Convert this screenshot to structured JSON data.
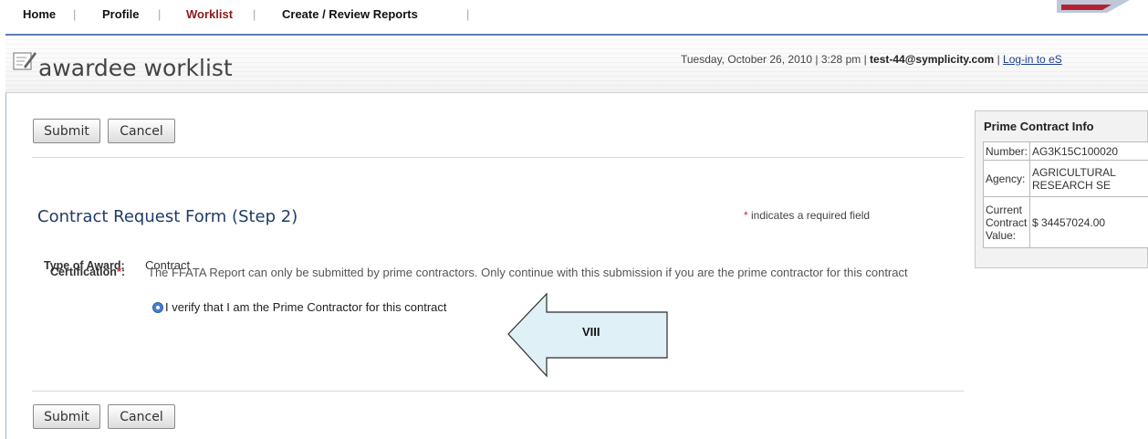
{
  "nav": {
    "items": [
      {
        "label": "Home"
      },
      {
        "label": "Profile"
      },
      {
        "label": "Worklist"
      },
      {
        "label": "Create / Review Reports"
      }
    ],
    "separator": "|"
  },
  "header": {
    "title": "awardee worklist",
    "datetime": "Tuesday, October 26, 2010 | 3:28 pm | ",
    "user": "test-44@symplicity.com",
    "sep": " | ",
    "login_link": "Log-in to eS"
  },
  "buttons": {
    "submit": "Submit",
    "cancel": "Cancel"
  },
  "form": {
    "title": "Contract Request Form (Step 2)",
    "required_star": "*",
    "required_note": " indicates a required field",
    "type_label": "Type of Award:",
    "type_value": "Contract",
    "cert_label": "Certification",
    "cert_star": "*",
    "cert_colon": ":",
    "cert_text": "The FFATA Report can only be submitted by prime contractors. Only continue with this submission if you are the prime contractor for this contract",
    "radio_label": "I verify that I am the Prime Contractor for this contract",
    "radio_checked": true
  },
  "panel": {
    "title": "Prime Contract Info",
    "rows": [
      {
        "key": "Number:",
        "value": "AG3K15C100020"
      },
      {
        "key": "Agency:",
        "value": "AGRICULTURAL RESEARCH SE"
      },
      {
        "key": "Current Contract Value:",
        "value": "$ 34457024.00"
      }
    ]
  },
  "annotation": {
    "label": "VIII",
    "fill": "#dff0f7",
    "stroke": "#2b2b2b"
  },
  "colors": {
    "nav_active": "#8b1a1a",
    "title_blue": "#1f3c68",
    "link": "#1a3f8f",
    "required": "#d22222"
  }
}
